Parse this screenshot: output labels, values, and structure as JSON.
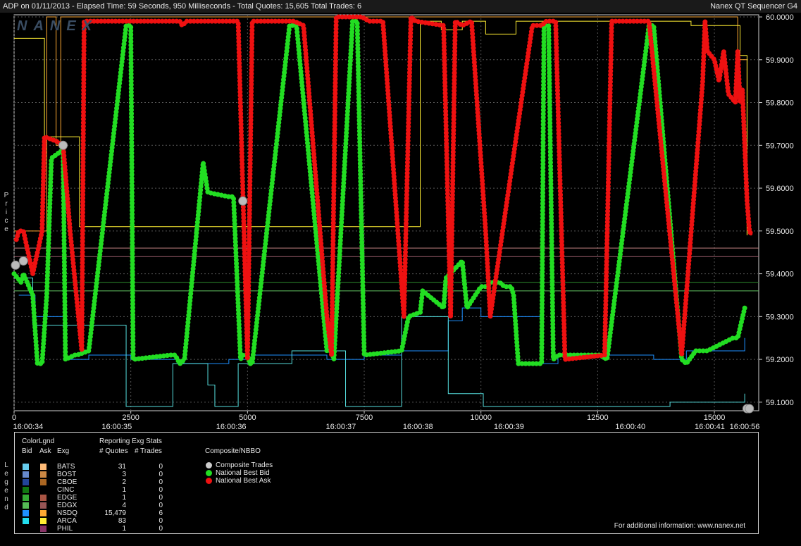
{
  "header": {
    "title": "ADP on 01/11/2013  -  Elapsed Time: 59 Seconds, 950 Milliseconds  -  Total Quotes: 15,605  Total Trades: 6",
    "app_name": "Nanex QT Sequencer G4"
  },
  "logo_text": "NANEX",
  "side_labels": {
    "price": "Price",
    "legend": "Legend"
  },
  "colors": {
    "bid": "#22dd22",
    "ask": "#ee1111",
    "trade": "#bbbbbb",
    "nsdq_bid": "#1e90ff",
    "arca_bid": "#55dddd",
    "nsdq_ask": "#ffaa33",
    "arca_ask": "#ffee33",
    "grid": "#555555"
  },
  "chart_data": {
    "type": "line",
    "x_axis": {
      "range": [
        0,
        15950
      ],
      "tick_values": [
        0,
        2500,
        5000,
        7500,
        10000,
        12500,
        15000
      ],
      "tick_labels": [
        "0",
        "2500",
        "5000",
        "7500",
        "10000",
        "12500",
        "15000"
      ],
      "time_ticks": [
        {
          "x": 300,
          "label": "16:00:34"
        },
        {
          "x": 2200,
          "label": "16:00:35"
        },
        {
          "x": 4650,
          "label": "16:00:36"
        },
        {
          "x": 7000,
          "label": "16:00:37"
        },
        {
          "x": 8650,
          "label": "16:00:38"
        },
        {
          "x": 10600,
          "label": "16:00:39"
        },
        {
          "x": 13200,
          "label": "16:00:40"
        },
        {
          "x": 14900,
          "label": "16:00:41"
        },
        {
          "x": 15700,
          "label": "16:00:56"
        }
      ]
    },
    "y_axis": {
      "range": [
        59.08,
        60.005
      ],
      "ticks": [
        60.0,
        59.9,
        59.8,
        59.7,
        59.6,
        59.5,
        59.4,
        59.3,
        59.2,
        59.1
      ],
      "tick_labels": [
        "60.0000",
        "59.9000",
        "59.8000",
        "59.7000",
        "59.6000",
        "59.5000",
        "59.4000",
        "59.3000",
        "59.2000",
        "59.1000"
      ]
    },
    "grid": true,
    "series": [
      {
        "name": "National Best Bid",
        "x": [
          0,
          150,
          200,
          400,
          500,
          600,
          700,
          800,
          1050,
          1100,
          1300,
          1350,
          1600,
          2400,
          2500,
          2550,
          3350,
          3450,
          3550,
          3650,
          4050,
          4150,
          4600,
          4700,
          4850,
          4900,
          5000,
          5050,
          5100,
          5900,
          6000,
          6050,
          6700,
          6800,
          6850,
          7250,
          7350,
          7500,
          8300,
          8450,
          8700,
          8750,
          9200,
          9250,
          9600,
          9700,
          10000,
          10150,
          10200,
          10400,
          10500,
          10650,
          10700,
          10800,
          11300,
          11350,
          11450,
          11550,
          11650,
          12550,
          12700,
          13600,
          13700,
          14300,
          14400,
          14600,
          14800,
          14850,
          15400,
          15500,
          15650
        ],
        "y": [
          59.4,
          59.38,
          59.4,
          59.35,
          59.19,
          59.19,
          59.35,
          59.67,
          59.69,
          59.2,
          59.21,
          59.21,
          59.22,
          59.98,
          59.98,
          59.2,
          59.21,
          59.21,
          59.19,
          59.2,
          59.66,
          59.59,
          59.58,
          59.58,
          59.2,
          59.21,
          59.21,
          59.19,
          59.19,
          59.98,
          59.98,
          59.98,
          59.22,
          59.22,
          59.2,
          59.99,
          59.99,
          59.21,
          59.22,
          59.3,
          59.31,
          59.36,
          59.32,
          59.39,
          59.43,
          59.32,
          59.37,
          59.37,
          59.38,
          59.38,
          59.37,
          59.37,
          59.35,
          59.19,
          59.19,
          59.98,
          59.98,
          59.2,
          59.21,
          59.21,
          59.2,
          59.98,
          59.98,
          59.2,
          59.19,
          59.22,
          59.22,
          59.22,
          59.25,
          59.25,
          59.32
        ]
      },
      {
        "name": "National Best Ask",
        "x": [
          50,
          100,
          200,
          300,
          400,
          600,
          650,
          900,
          1050,
          1200,
          1450,
          1500,
          2300,
          2500,
          2600,
          3550,
          3600,
          3700,
          4200,
          4800,
          5000,
          5100,
          6000,
          6200,
          6700,
          6800,
          6900,
          7450,
          7600,
          7800,
          7900,
          8350,
          8500,
          8600,
          9200,
          9350,
          9450,
          9600,
          9800,
          10100,
          10200,
          11100,
          11300,
          11400,
          11600,
          11800,
          12650,
          12800,
          13200,
          13500,
          13600,
          14300,
          14750,
          14800,
          14850,
          15000,
          15100,
          15200,
          15300,
          15450,
          15500,
          15550,
          15600,
          15700,
          15750,
          15800
        ],
        "y": [
          59.48,
          59.5,
          59.5,
          59.45,
          59.4,
          59.5,
          59.72,
          59.71,
          59.7,
          59.5,
          59.22,
          59.99,
          59.99,
          59.99,
          59.99,
          59.99,
          59.98,
          59.99,
          59.99,
          59.99,
          59.2,
          59.99,
          59.99,
          59.98,
          59.3,
          59.21,
          60.0,
          60.0,
          59.99,
          59.99,
          59.99,
          59.3,
          60.0,
          59.99,
          59.98,
          59.3,
          59.99,
          59.98,
          59.99,
          59.5,
          59.3,
          59.98,
          59.98,
          59.99,
          59.99,
          59.2,
          59.21,
          59.99,
          59.99,
          59.99,
          59.99,
          59.21,
          59.85,
          59.99,
          59.92,
          59.9,
          59.85,
          59.92,
          59.82,
          59.8,
          59.92,
          59.8,
          59.83,
          59.57,
          59.5,
          59.49
        ]
      },
      {
        "name": "Composite Trades",
        "x": [
          30,
          200,
          1050,
          4900,
          15700,
          15750
        ],
        "y": [
          59.42,
          59.43,
          59.7,
          59.57,
          59.08,
          59.08
        ]
      }
    ],
    "exchange_bid_lines": [
      {
        "exchange": "NSDQ",
        "color": "#1e90ff",
        "x": [
          100,
          450,
          1100,
          1600,
          2500,
          3550,
          4600,
          5100,
          6700,
          7500,
          8300,
          9300,
          9600,
          10000,
          11300,
          11650,
          13700,
          14400,
          15650
        ],
        "y": [
          59.35,
          59.3,
          59.2,
          59.21,
          59.2,
          59.19,
          59.2,
          59.21,
          59.2,
          59.21,
          59.22,
          59.29,
          59.32,
          59.3,
          59.19,
          59.21,
          59.2,
          59.22,
          59.25
        ]
      },
      {
        "exchange": "ARCA",
        "color": "#55dddd",
        "x": [
          0,
          400,
          2400,
          3400,
          4150,
          4300,
          4800,
          5950,
          7100,
          8300,
          9300,
          10050,
          11300,
          12750,
          14050,
          15650
        ],
        "y": [
          59.39,
          59.28,
          59.09,
          59.19,
          59.14,
          59.09,
          59.19,
          59.22,
          59.09,
          59.3,
          59.12,
          59.09,
          59.09,
          59.09,
          59.1,
          59.12
        ]
      }
    ],
    "exchange_ask_lines": [
      {
        "exchange": "NSDQ",
        "color": "#ffaa33",
        "x": [
          0,
          600,
          700,
          900,
          1000,
          1400,
          2300,
          3600,
          4500,
          6400,
          6950,
          7500,
          8800,
          9150,
          9600,
          10100,
          11200,
          12650,
          14300,
          15500,
          15700
        ],
        "y": [
          59.5,
          59.5,
          60.0,
          59.7,
          60.0,
          60.0,
          60.0,
          60.0,
          60.0,
          60.0,
          60.0,
          60.0,
          60.0,
          60.0,
          60.0,
          60.0,
          60.0,
          60.0,
          60.0,
          59.9,
          59.49
        ]
      },
      {
        "exchange": "ARCA",
        "color": "#ffee33",
        "x": [
          0,
          600,
          650,
          1100,
          1400,
          8700,
          9150,
          9500,
          9600,
          10100,
          10600,
          10750,
          14300,
          14500,
          15000,
          15550,
          15700
        ],
        "y": [
          59.95,
          59.95,
          59.72,
          59.72,
          59.51,
          59.99,
          59.97,
          59.97,
          59.99,
          59.96,
          59.96,
          59.99,
          59.99,
          59.98,
          59.98,
          59.91,
          59.49
        ]
      }
    ],
    "reference_lines": [
      {
        "y": 59.46,
        "color": "#c08080"
      },
      {
        "y": 59.44,
        "color": "#a06070"
      },
      {
        "y": 59.38,
        "color": "#2e8b2e"
      },
      {
        "y": 59.36,
        "color": "#60c060"
      }
    ]
  },
  "legend": {
    "col_headers": {
      "colorlgnd": "ColorLgnd",
      "bid": "Bid",
      "ask": "Ask",
      "exg": "Exg",
      "reporting": "Reporting Exg Stats",
      "quotes": "# Quotes",
      "trades": "# Trades",
      "composite": "Composite/NBBO"
    },
    "exchanges": [
      {
        "name": "BATS",
        "bid_color": "#66ccee",
        "ask_color": "#ffbb77",
        "quotes": "31",
        "trades": "0"
      },
      {
        "name": "BOST",
        "bid_color": "#6688cc",
        "ask_color": "#cc8844",
        "quotes": "3",
        "trades": "0"
      },
      {
        "name": "CBOE",
        "bid_color": "#224499",
        "ask_color": "#aa6622",
        "quotes": "2",
        "trades": "0"
      },
      {
        "name": "CINC",
        "bid_color": "#117711",
        "ask_color": "#000000",
        "quotes": "1",
        "trades": "0"
      },
      {
        "name": "EDGE",
        "bid_color": "#33aa33",
        "ask_color": "#aa5544",
        "quotes": "1",
        "trades": "0"
      },
      {
        "name": "EDGX",
        "bid_color": "#55bb55",
        "ask_color": "#995555",
        "quotes": "4",
        "trades": "0"
      },
      {
        "name": "NSDQ",
        "bid_color": "#1e90ff",
        "ask_color": "#ffaa33",
        "quotes": "15,479",
        "trades": "6"
      },
      {
        "name": "ARCA",
        "bid_color": "#22ddee",
        "ask_color": "#ffee33",
        "quotes": "83",
        "trades": "0"
      },
      {
        "name": "PHIL",
        "bid_color": "#000000",
        "ask_color": "#883366",
        "quotes": "1",
        "trades": "0"
      }
    ],
    "composite": [
      {
        "label": "Composite Trades",
        "color": "#cccccc"
      },
      {
        "label": "National Best Bid",
        "color": "#22dd22"
      },
      {
        "label": "National Best Ask",
        "color": "#ee1111"
      }
    ],
    "footer": "For additional information: www.nanex.net"
  }
}
